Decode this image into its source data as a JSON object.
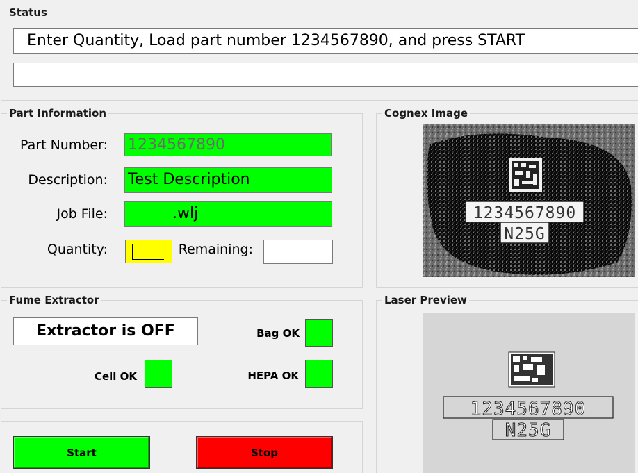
{
  "status": {
    "title": "Status",
    "line1": "Enter Quantity, Load part number 1234567890, and press START",
    "line2": ""
  },
  "part_info": {
    "title": "Part Information",
    "part_number_label": "Part Number:",
    "part_number_value": "1234567890",
    "description_label": "Description:",
    "description_value": "Test Description",
    "job_file_label": "Job File:",
    "job_file_value": ".wlj",
    "quantity_label": "Quantity:",
    "quantity_value": "",
    "remaining_label": "Remaining:",
    "remaining_value": ""
  },
  "cognex": {
    "title": "Cognex Image",
    "code_text": "1234567890",
    "sub_text": "N25G"
  },
  "fume": {
    "title": "Fume Extractor",
    "status_text": "Extractor is OFF",
    "bag_label": "Bag OK",
    "cell_label": "Cell OK",
    "hepa_label": "HEPA OK"
  },
  "laser": {
    "title": "Laser Preview",
    "code_text": "1234567890",
    "sub_text": "N25G"
  },
  "controls": {
    "start_label": "Start",
    "stop_label": "Stop"
  },
  "colors": {
    "ok_green": "#00ff00",
    "stop_red": "#ff0000",
    "quantity_yellow": "#ffff00"
  }
}
